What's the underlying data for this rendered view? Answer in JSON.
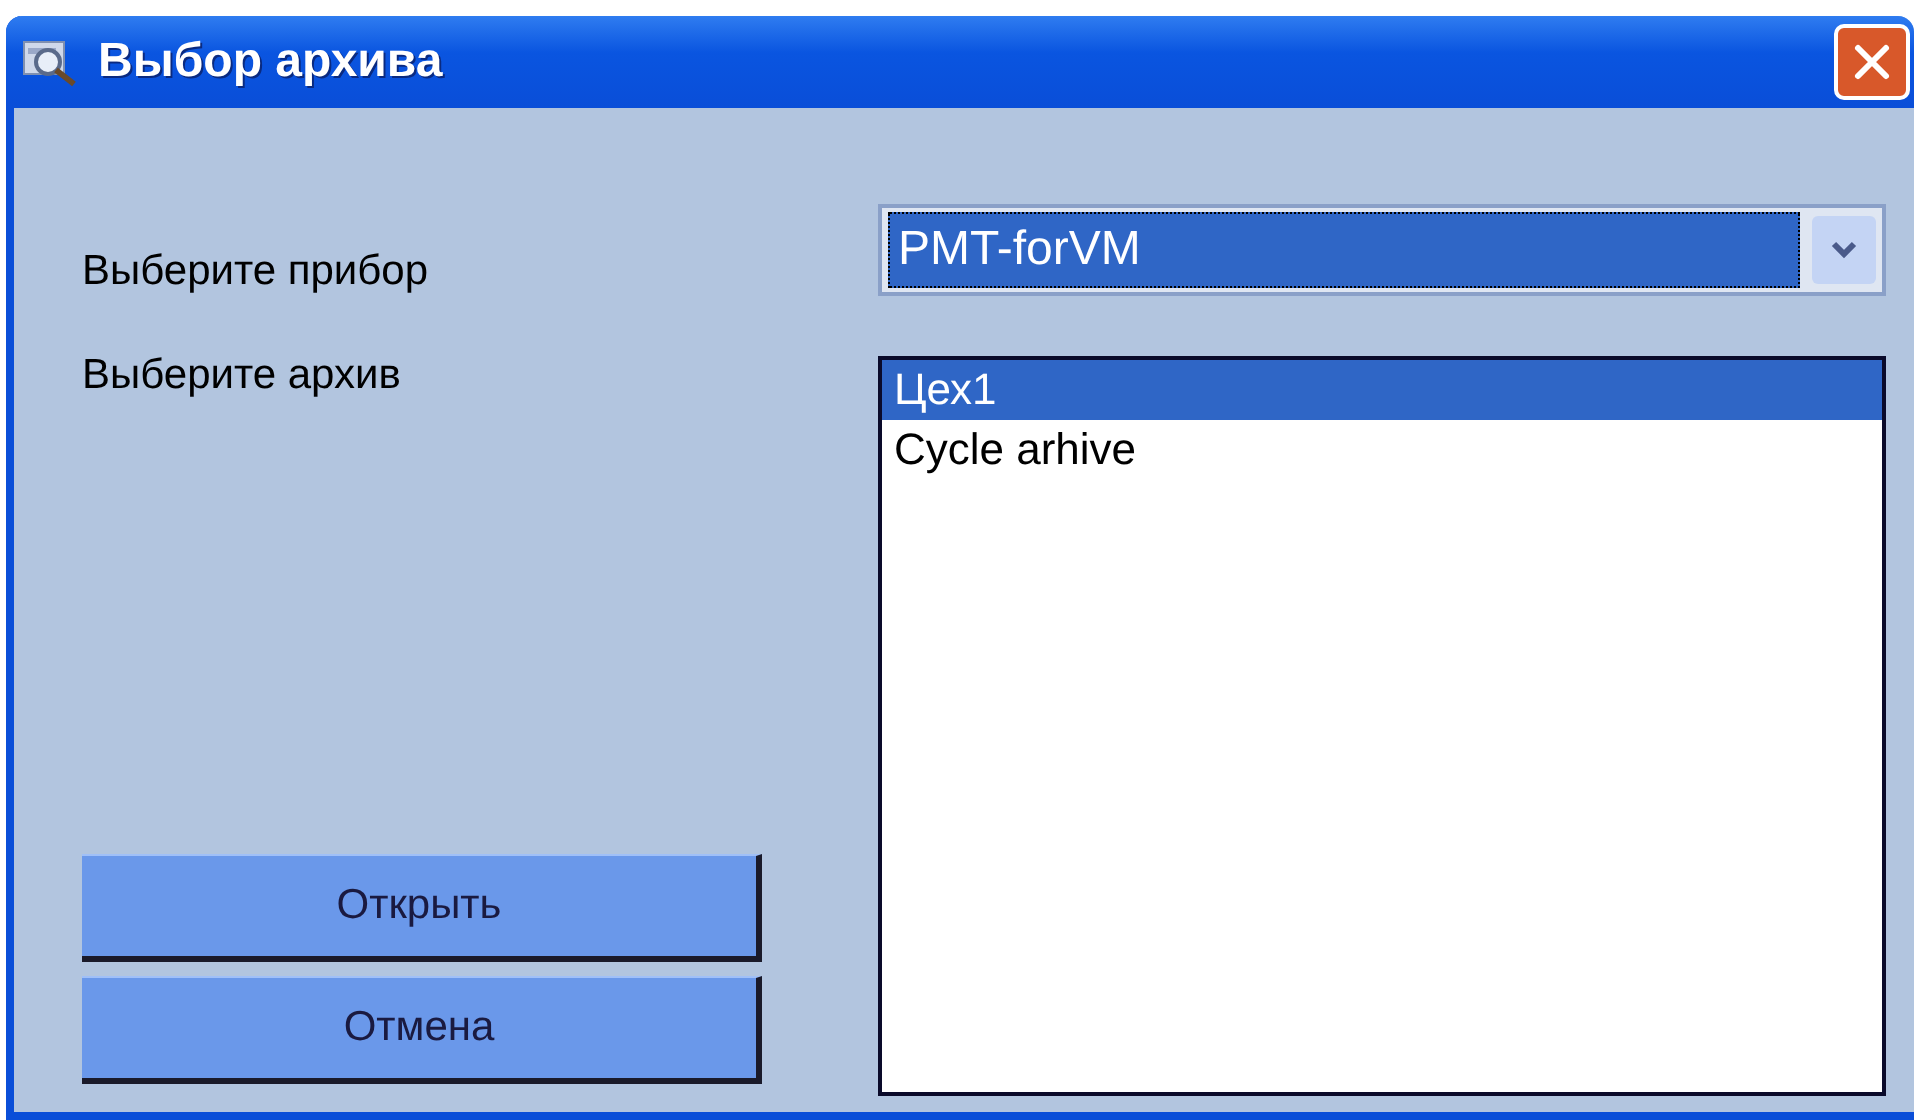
{
  "window": {
    "title": "Выбор архива"
  },
  "device": {
    "label": "Выберите прибор",
    "value": "PMT-forVM"
  },
  "archive": {
    "label": "Выберите архив",
    "items": [
      {
        "text": "Цех1",
        "selected": true
      },
      {
        "text": "Cycle arhive",
        "selected": false
      }
    ]
  },
  "buttons": [
    "Открыть",
    "Отмена"
  ]
}
